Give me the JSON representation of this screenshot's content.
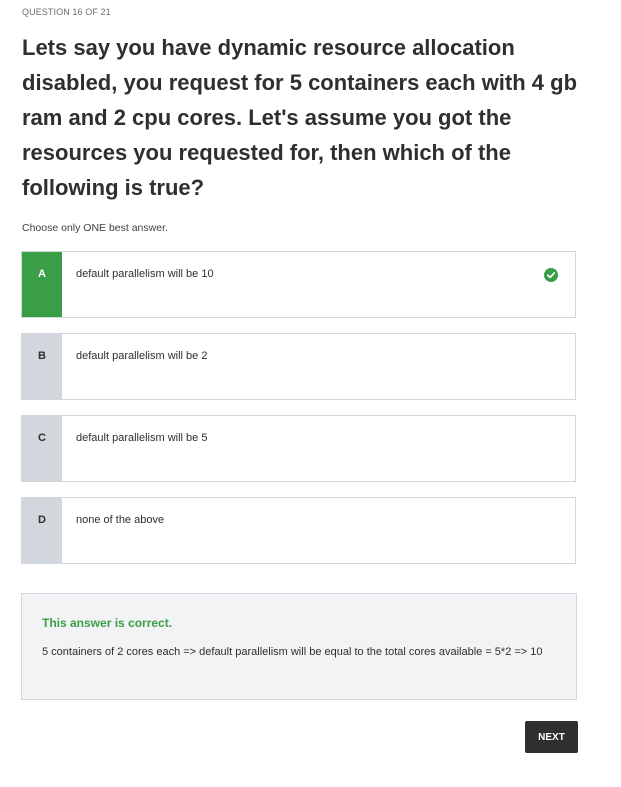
{
  "header": {
    "counter": "QUESTION 16 OF 21"
  },
  "question": {
    "text": "Lets say you have dynamic resource allocation disabled, you request for 5 containers each with 4 gb ram and 2 cpu cores. Let's assume you got the resources you requested for, then which of the following is true?",
    "instruction": "Choose only ONE best answer."
  },
  "options": [
    {
      "letter": "A",
      "text": "default parallelism will be 10",
      "state": "correct",
      "icon": "check-circle-icon"
    },
    {
      "letter": "B",
      "text": "default parallelism will be 2",
      "state": "default"
    },
    {
      "letter": "C",
      "text": "default parallelism will be 5",
      "state": "default"
    },
    {
      "letter": "D",
      "text": "none of the above",
      "state": "default"
    }
  ],
  "feedback": {
    "status": "This answer is correct.",
    "explanation": "5 containers of 2 cores each => default parallelism will be equal to the total cores available = 5*2 => 10"
  },
  "actions": {
    "next_label": "NEXT"
  },
  "colors": {
    "correct": "#3a9e47",
    "letter_bg": "#d1d7dc",
    "text": "#2d2f31",
    "button_bg": "#2d2f31"
  }
}
